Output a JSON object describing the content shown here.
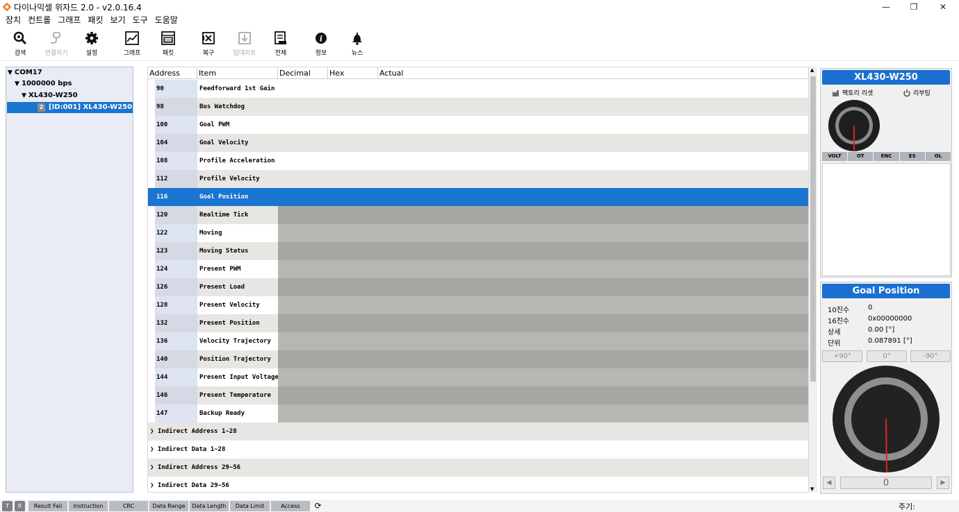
{
  "window": {
    "title": "다이나믹셀 위자드 2.0 - v2.0.16.4",
    "minimize": "—",
    "maximize": "❐",
    "close": "✕"
  },
  "menu": [
    "장치",
    "컨트롤",
    "그래프",
    "패킷",
    "보기",
    "도구",
    "도움말"
  ],
  "toolbar": [
    {
      "label": "검색",
      "icon": "search-icon",
      "enabled": true
    },
    {
      "label": "연결하기",
      "icon": "plug-icon",
      "enabled": false
    },
    {
      "label": "설정",
      "icon": "gear-icon",
      "enabled": true
    },
    {
      "label": "그래프",
      "icon": "chart-icon",
      "enabled": true
    },
    {
      "label": "패킷",
      "icon": "packet-icon",
      "enabled": true
    },
    {
      "label": "복구",
      "icon": "recover-icon",
      "enabled": true
    },
    {
      "label": "업데이트",
      "icon": "download-icon",
      "enabled": false
    },
    {
      "label": "전체",
      "icon": "all-icon",
      "enabled": true
    },
    {
      "label": "정보",
      "icon": "info-icon",
      "enabled": true
    },
    {
      "label": "뉴스",
      "icon": "bell-icon",
      "enabled": true
    }
  ],
  "tree": {
    "port": "COM17",
    "baud": "1000000 bps",
    "model": "XL430-W250",
    "device_num": "2",
    "device": "[ID:001] XL430-W250"
  },
  "table": {
    "headers": [
      "Address",
      "Item",
      "Decimal",
      "Hex",
      "Actual"
    ],
    "rows": [
      {
        "address": "90",
        "item": "Feedforward 1st Gain",
        "state": "normal"
      },
      {
        "address": "98",
        "item": "Bus Watchdog",
        "state": "normal"
      },
      {
        "address": "100",
        "item": "Goal PWM",
        "state": "normal"
      },
      {
        "address": "104",
        "item": "Goal Velocity",
        "state": "normal"
      },
      {
        "address": "108",
        "item": "Profile Acceleration",
        "state": "normal"
      },
      {
        "address": "112",
        "item": "Profile Velocity",
        "state": "normal"
      },
      {
        "address": "116",
        "item": "Goal Position",
        "state": "selected"
      },
      {
        "address": "120",
        "item": "Realtime Tick",
        "state": "readonly"
      },
      {
        "address": "122",
        "item": "Moving",
        "state": "readonly"
      },
      {
        "address": "123",
        "item": "Moving Status",
        "state": "readonly"
      },
      {
        "address": "124",
        "item": "Present PWM",
        "state": "readonly"
      },
      {
        "address": "126",
        "item": "Present Load",
        "state": "readonly"
      },
      {
        "address": "128",
        "item": "Present Velocity",
        "state": "readonly"
      },
      {
        "address": "132",
        "item": "Present Position",
        "state": "readonly"
      },
      {
        "address": "136",
        "item": "Velocity Trajectory",
        "state": "readonly"
      },
      {
        "address": "140",
        "item": "Position Trajectory",
        "state": "readonly"
      },
      {
        "address": "144",
        "item": "Present Input Voltage",
        "state": "readonly"
      },
      {
        "address": "146",
        "item": "Present Temperature",
        "state": "readonly"
      },
      {
        "address": "147",
        "item": "Backup Ready",
        "state": "readonly"
      }
    ],
    "groups": [
      "Indirect Address 1~28",
      "Indirect Data 1~28",
      "Indirect Address 29~56",
      "Indirect Data 29~56"
    ]
  },
  "device_panel": {
    "title": "XL430-W250",
    "factory_reset": "팩토리 리셋",
    "reboot": "리부팅",
    "status": [
      "VOLT",
      "OT",
      "ENC",
      "ES",
      "OL"
    ]
  },
  "goal_panel": {
    "title": "Goal Position",
    "fields": [
      {
        "label": "10진수",
        "value": "0"
      },
      {
        "label": "16진수",
        "value": "0x00000000"
      },
      {
        "label": "상세",
        "value": "0.00 [°]"
      },
      {
        "label": "단위",
        "value": "0.087891 [°]"
      }
    ],
    "buttons": [
      "+90°",
      "0°",
      "-90°"
    ],
    "input_value": "0",
    "prev": "◀",
    "next": "▶"
  },
  "statusbar": {
    "t": "T",
    "r": "R",
    "items": [
      "Result Fail",
      "Instruction",
      "CRC",
      "Data Range",
      "Data Length",
      "Data Limit",
      "Access"
    ],
    "refresh": "⟳",
    "period_label": "주기:"
  },
  "colors": {
    "accent": "#1a75d0",
    "row_alt": "#e8e6e3",
    "readonly": "#a8a6a3",
    "readonly_alt": "#b8b6b3",
    "address_cell": "#dde3f0"
  }
}
